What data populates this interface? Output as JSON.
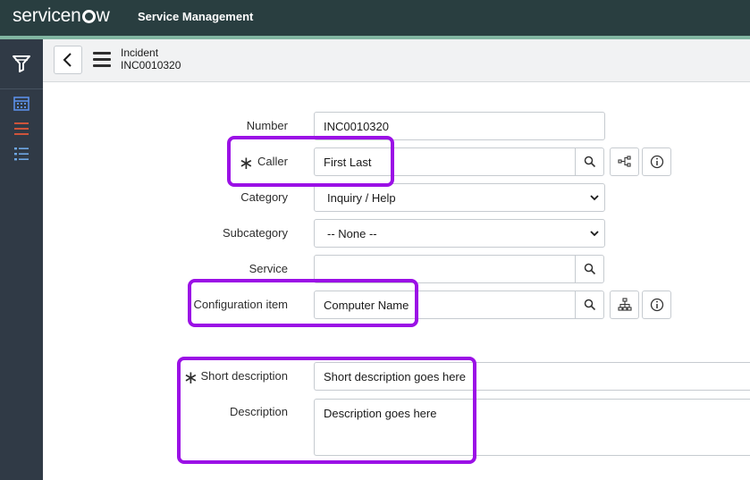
{
  "banner": {
    "logo_before": "servicen",
    "logo_after": "w",
    "app_title": "Service Management",
    "background": "#293e40"
  },
  "nav": {
    "icons": [
      "filter-icon",
      "calendar-icon",
      "list-icon",
      "list-detail-icon"
    ]
  },
  "header": {
    "record_type": "Incident",
    "record_number": "INC0010320"
  },
  "form": {
    "number": {
      "label": "Number",
      "value": "INC0010320"
    },
    "caller": {
      "label": "Caller",
      "value": "First Last",
      "required": true
    },
    "category": {
      "label": "Category",
      "value": "Inquiry / Help"
    },
    "subcategory": {
      "label": "Subcategory",
      "value": "-- None --"
    },
    "service": {
      "label": "Service",
      "value": ""
    },
    "configuration_item": {
      "label": "Configuration item",
      "value": "Computer Name"
    },
    "short_description": {
      "label": "Short description",
      "value": "Short description goes here",
      "required": true
    },
    "description": {
      "label": "Description",
      "value": "Description goes here"
    },
    "required_marker": "∗"
  },
  "highlight_color": "#9b10e6"
}
